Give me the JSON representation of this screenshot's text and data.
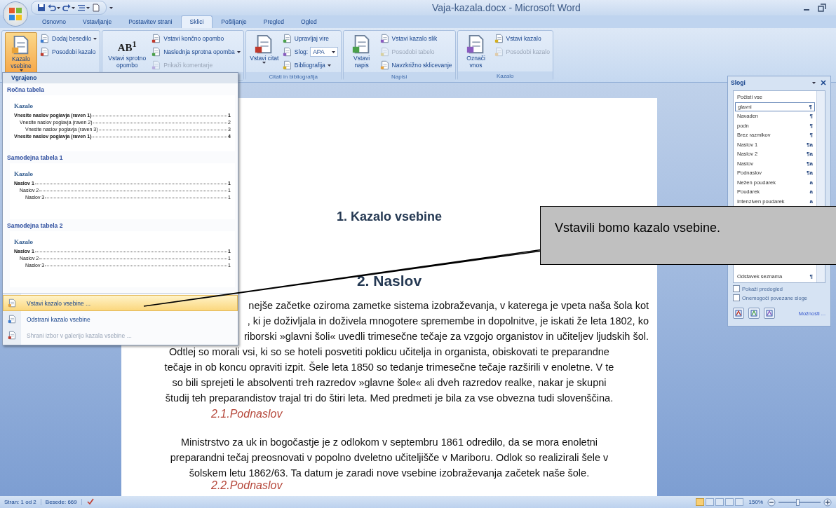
{
  "window": {
    "title": "Vaja-kazala.docx - Microsoft Word"
  },
  "tabs": [
    {
      "label": "Osnovno",
      "selected": false
    },
    {
      "label": "Vstavljanje",
      "selected": false
    },
    {
      "label": "Postavitev strani",
      "selected": false
    },
    {
      "label": "Sklici",
      "selected": true
    },
    {
      "label": "Pošiljanje",
      "selected": false
    },
    {
      "label": "Pregled",
      "selected": false
    },
    {
      "label": "Ogled",
      "selected": false
    }
  ],
  "ribbon": {
    "groups": [
      {
        "columns": [
          {
            "kind": "large",
            "label": "Kazalo vsebine",
            "dropdown": true,
            "pressed": true
          },
          {
            "kind": "stack",
            "items": [
              {
                "kind": "button",
                "label": "Dodaj besedilo",
                "dropdown": true,
                "disabled": false
              },
              {
                "kind": "button",
                "label": "Posodobi kazalo",
                "dropdown": false,
                "disabled": false
              }
            ]
          }
        ]
      },
      {
        "columns": [
          {
            "kind": "large",
            "label": "Vstavi sprotno opombo",
            "icon_text": "AB$^{1}$",
            "dropdown": false,
            "pressed": false
          },
          {
            "kind": "stack",
            "items": [
              {
                "kind": "button",
                "label": "Vstavi končno opombo",
                "dropdown": false,
                "disabled": false
              },
              {
                "kind": "button",
                "label": "Naslednja sprotna opomba",
                "dropdown": true,
                "disabled": false
              },
              {
                "kind": "button",
                "label": "Prikaži komentarje",
                "dropdown": false,
                "disabled": true
              }
            ]
          }
        ]
      },
      {
        "label": "Citati in bibliografija",
        "columns": [
          {
            "kind": "large",
            "label": "Vstavi citat",
            "dropdown": true,
            "pressed": false
          },
          {
            "kind": "stack",
            "items": [
              {
                "kind": "button",
                "label": "Upravljaj vire",
                "dropdown": false,
                "disabled": false
              },
              {
                "kind": "combo",
                "label": "Slog:",
                "value": "APA",
                "dropdown": true,
                "disabled": false
              },
              {
                "kind": "button",
                "label": "Bibliografija",
                "dropdown": true,
                "disabled": false
              }
            ]
          }
        ]
      },
      {
        "label": "Napisi",
        "columns": [
          {
            "kind": "large",
            "label": "Vstavi napis",
            "dropdown": false,
            "pressed": false
          },
          {
            "kind": "stack",
            "items": [
              {
                "kind": "button",
                "label": "Vstavi kazalo slik",
                "dropdown": false,
                "disabled": false
              },
              {
                "kind": "button",
                "label": "Posodobi tabelo",
                "dropdown": false,
                "disabled": true
              },
              {
                "kind": "button",
                "label": "Navzkrižno sklicevanje",
                "dropdown": false,
                "disabled": false
              }
            ]
          }
        ]
      },
      {
        "label": "Kazalo",
        "columns": [
          {
            "kind": "large",
            "label": "Označi vnos",
            "dropdown": false,
            "pressed": false
          },
          {
            "kind": "stack",
            "items": [
              {
                "kind": "button",
                "label": "Vstavi kazalo",
                "dropdown": false,
                "disabled": false
              },
              {
                "kind": "button",
                "label": "Posodobi kazalo",
                "dropdown": false,
                "disabled": true
              }
            ]
          }
        ]
      }
    ]
  },
  "toc_menu": {
    "header": "Vgrajeno",
    "galleries": [
      {
        "title": "Ročna tabela",
        "preview": {
          "heading": "Kazalo",
          "entries": [
            {
              "text": "Vnesite naslov poglavja (raven 1)",
              "page": "1",
              "children": [
                {
                  "text": "Vnesite naslov poglavja (raven 2)",
                  "page": "2",
                  "children": [
                    {
                      "text": "Vnesite naslov poglavja (raven 3)",
                      "page": "3"
                    }
                  ]
                }
              ]
            },
            {
              "text": "Vnesite naslov poglavja (raven 1)",
              "page": "4"
            }
          ]
        }
      },
      {
        "title": "Samodejna tabela 1",
        "preview": {
          "heading": "Kazalo",
          "entries": [
            {
              "text": "Naslov 1",
              "page": "1",
              "children": [
                {
                  "text": "Naslov 2",
                  "page": "1",
                  "children": [
                    {
                      "text": "Naslov 3",
                      "page": "1"
                    }
                  ]
                }
              ]
            }
          ]
        }
      },
      {
        "title": "Samodejna tabela 2",
        "preview": {
          "heading": "Kazalo",
          "entries": [
            {
              "text": "Naslov 1",
              "page": "1",
              "children": [
                {
                  "text": "Naslov 2",
                  "page": "1",
                  "children": [
                    {
                      "text": "Naslov 3",
                      "page": "1"
                    }
                  ]
                }
              ]
            }
          ]
        }
      }
    ],
    "commands": [
      {
        "label": "Vstavi kazalo vsebine ...",
        "selected": true,
        "disabled": false
      },
      {
        "label": "Odstrani kazalo vsebine",
        "selected": false,
        "disabled": false
      },
      {
        "label": "Shrani izbor v galerijo kazala vsebine ...",
        "selected": false,
        "disabled": true
      }
    ]
  },
  "document": {
    "heading_1": "1. Kazalo vsebine",
    "heading_2": "2. Naslov",
    "paragraph_1": [
      {
        "kind": "cut",
        "text": "nejše začetke oziroma zametke sistema izobraževanja, v katerega je vpeta naša šola kot"
      },
      {
        "kind": "cut",
        "text": ", ki je doživljala in doživela mnogotere spremembe in dopolnitve, je iskati že leta 1802, ko"
      },
      {
        "kind": "cut",
        "text": "riborski »glavni šoli« uvedli trimesečne tečaje za vzgojo organistov in učiteljev ljudskih šol."
      },
      {
        "kind": "full",
        "text": "Odtlej so morali vsi, ki so se hoteli posvetiti poklicu učitelja in organista, obiskovati te preparandne"
      },
      {
        "kind": "full",
        "text": "tečaje in ob koncu opraviti izpit. Šele leta 1850 so tedanje trimesečne tečaje razširili v enoletne. V te"
      },
      {
        "kind": "full",
        "text": "so bili sprejeti le absolventi treh razredov »glavne šole« ali dveh razredov realke, nakar je skupni"
      },
      {
        "kind": "full",
        "text": "študij teh preparandistov trajal tri do štiri leta. Med predmeti je bila za vse obvezna tudi slovenščina."
      }
    ],
    "subheading_1": "2.1.Podnaslov",
    "paragraph_2": [
      {
        "kind": "full",
        "text": "Ministrstvo za uk in bogočastje je z odlokom v septembru 1861 odredilo, da se mora enoletni"
      },
      {
        "kind": "full",
        "text": "preparandni tečaj preosnovati v popolno dveletno učiteljišče v Mariboru. Odlok so realizirali šele v"
      },
      {
        "kind": "full",
        "text": "šolskem letu 1862/63. Ta datum je zaradi nove vsebine izobraževanja začetek naše šole."
      }
    ],
    "subheading_2": "2.2.Podnaslov"
  },
  "styles_pane": {
    "title": "Slogi",
    "items": [
      {
        "label": "Počisti vse",
        "selected": false
      },
      {
        "label": "glavni",
        "mark": "¶",
        "selected": true
      },
      {
        "label": "Navaden",
        "mark": "¶",
        "selected": false
      },
      {
        "label": "podn",
        "mark": "¶",
        "selected": false
      },
      {
        "label": "Brez razmikov",
        "mark": "¶",
        "selected": false
      },
      {
        "label": "Naslov 1",
        "mark": "¶a",
        "selected": false
      },
      {
        "label": "Naslov 2",
        "mark": "¶a",
        "selected": false
      },
      {
        "label": "Naslov",
        "mark": "¶a",
        "selected": false
      },
      {
        "label": "Podnaslov",
        "mark": "¶a",
        "selected": false
      },
      {
        "label": "Nežen poudarek",
        "mark": "a",
        "selected": false
      },
      {
        "label": "Poudarek",
        "mark": "a",
        "selected": false
      },
      {
        "label": "Intenziven poudarek",
        "mark": "a",
        "selected": false
      },
      {
        "label": "Odstavek seznama",
        "mark": "¶",
        "selected": false
      }
    ],
    "options": [
      {
        "label": "Pokaži predogled",
        "checked": false
      },
      {
        "label": "Onemogoči povezane sloge",
        "checked": false
      }
    ],
    "link": "Možnosti ..."
  },
  "callout": {
    "text": "Vstavili bomo kazalo vsebine."
  },
  "status_bar": {
    "page": "Stran: 1 od 2",
    "words": "Besede: 669",
    "views": [
      {
        "selected": true
      },
      {
        "selected": false
      },
      {
        "selected": false
      },
      {
        "selected": false
      },
      {
        "selected": false
      }
    ],
    "zoom": "150%",
    "zoom_slider": {
      "level": 0.45
    }
  }
}
